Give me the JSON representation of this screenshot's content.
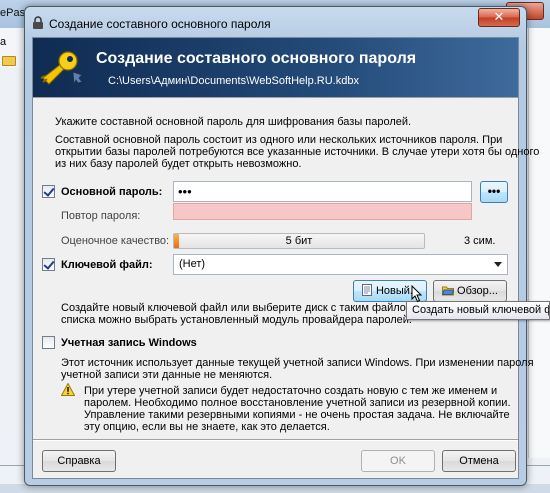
{
  "background": {
    "title_fragment": "ePass",
    "label_fragment": "а"
  },
  "window": {
    "title": "Создание составного основного пароля",
    "close_glyph": "✕"
  },
  "banner": {
    "title": "Создание составного основного пароля",
    "path": "C:\\Users\\Админ\\Documents\\WebSoftHelp.RU.kdbx"
  },
  "intro": {
    "line1": "Укажите составной основной пароль для шифрования базы паролей.",
    "desc1": "Составной основной пароль состоит из одного или нескольких источников пароля. При",
    "desc2": "открытии базы паролей потребуются все указанные источники. В случае утери хотя бы одного",
    "desc3": "из них базу паролей будет открыть невозможно."
  },
  "password": {
    "label": "Основной пароль:",
    "value": "•••",
    "reveal_label": "•••",
    "checked": true
  },
  "repeat": {
    "label": "Повтор пароля:",
    "value": ""
  },
  "quality": {
    "label": "Оценочное качество:",
    "text": "5 бит",
    "fill_fraction": 0.02,
    "chars": "3 сим."
  },
  "keyfile": {
    "label": "Ключевой файл:",
    "selected": "(Нет)",
    "checked": true,
    "new_button": "Новый...",
    "browse_button": "Обзор...",
    "hint1": "Создайте новый ключевой файл или выберите диск с таким файлом. Из выпадающего",
    "hint2": "списка можно выбрать установленный модуль провайдера паролей."
  },
  "tooltip": "Создать новый ключевой файл",
  "windows_account": {
    "label": "Учетная запись Windows",
    "checked": false,
    "desc1": "Этот источник использует данные текущей учетной записи Windows. При изменении пароля",
    "desc2": "учетной записи эти данные не меняются.",
    "warn1": "При утере учетной записи будет недостаточно создать новую с тем же именем и",
    "warn2": "паролем. Необходимо полное восстановление учетной записи из резервной копии.",
    "warn3": "Управление такими резервными копиями - не очень простая задача. Не включайте",
    "warn4": "эту опцию, если вы не знаете, как это делается."
  },
  "footer": {
    "help": "Справка",
    "ok": "OK",
    "cancel": "Отмена"
  }
}
